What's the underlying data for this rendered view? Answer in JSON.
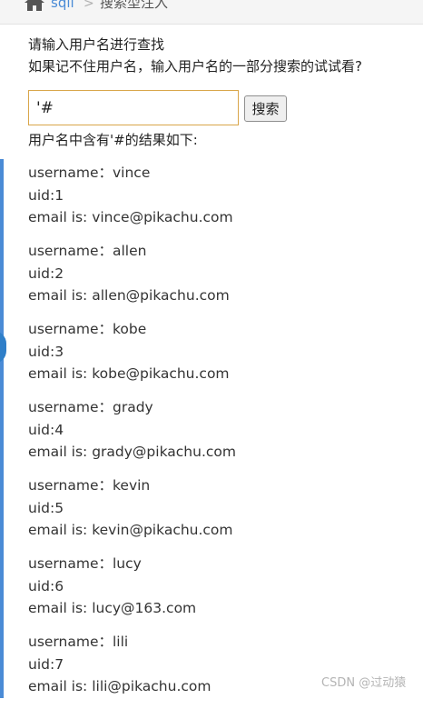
{
  "breadcrumb": {
    "home_icon": "home-icon",
    "link": "sqli",
    "separator": ">",
    "current": "搜索型注入"
  },
  "instructions": {
    "line1": "请输入用户名进行查找",
    "line2": "如果记不住用户名，输入用户名的一部分搜索的试试看?"
  },
  "search": {
    "value": "'#",
    "button_label": "搜索"
  },
  "result_heading": "用户名中含有'#的结果如下:",
  "results": [
    {
      "username": "username：vince",
      "uid": "uid:1",
      "email": "email is: vince@pikachu.com"
    },
    {
      "username": "username：allen",
      "uid": "uid:2",
      "email": "email is: allen@pikachu.com"
    },
    {
      "username": "username：kobe",
      "uid": "uid:3",
      "email": "email is: kobe@pikachu.com"
    },
    {
      "username": "username：grady",
      "uid": "uid:4",
      "email": "email is: grady@pikachu.com"
    },
    {
      "username": "username：kevin",
      "uid": "uid:5",
      "email": "email is: kevin@pikachu.com"
    },
    {
      "username": "username：lucy",
      "uid": "uid:6",
      "email": "email is: lucy@163.com"
    },
    {
      "username": "username：lili",
      "uid": "uid:7",
      "email": "email is: lili@pikachu.com"
    }
  ],
  "watermark": "CSDN @过动猿",
  "colors": {
    "link": "#4a8bd6",
    "input_border": "#d9a64a",
    "side_bar": "#4a8bd6"
  }
}
